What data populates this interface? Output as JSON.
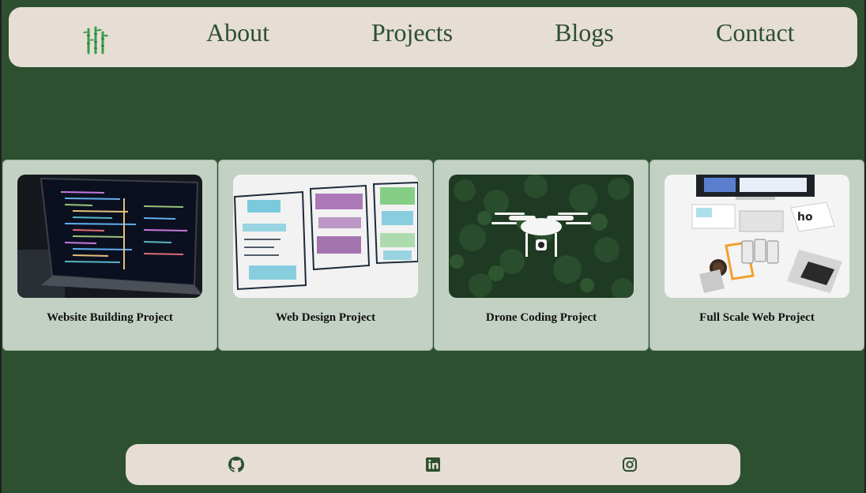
{
  "nav": {
    "logo_icon": "bamboo-icon",
    "items": [
      {
        "label": "About"
      },
      {
        "label": "Projects"
      },
      {
        "label": "Blogs"
      },
      {
        "label": "Contact"
      }
    ]
  },
  "projects": [
    {
      "title": "Website Building Project",
      "image": "laptop-code-image"
    },
    {
      "title": "Web Design Project",
      "image": "wireframe-sketch-image"
    },
    {
      "title": "Drone Coding Project",
      "image": "drone-forest-image"
    },
    {
      "title": "Full Scale Web Project",
      "image": "desk-devices-image"
    }
  ],
  "footer": {
    "links": [
      {
        "icon": "github-icon"
      },
      {
        "icon": "linkedin-icon"
      },
      {
        "icon": "instagram-icon"
      }
    ]
  },
  "colors": {
    "page_background": "#2c5030",
    "nav_background": "#e6ddd4",
    "card_background": "#c3d1c4",
    "accent_green": "#2c5030"
  }
}
